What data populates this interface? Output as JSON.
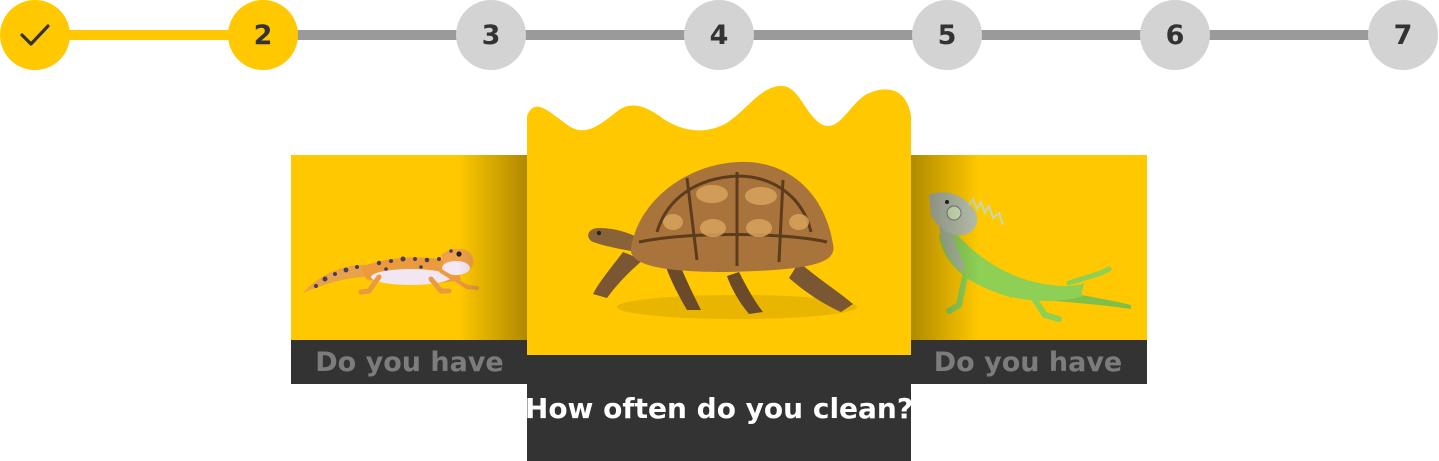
{
  "stepper": {
    "accent_color": "#FFC800",
    "pending_color": "#d3d3d3",
    "track_color": "#9a9a9a",
    "steps": [
      {
        "state": "completed",
        "label": "",
        "icon": "checkmark-icon"
      },
      {
        "state": "current",
        "label": "2"
      },
      {
        "state": "pending",
        "label": "3"
      },
      {
        "state": "pending",
        "label": "4"
      },
      {
        "state": "pending",
        "label": "5"
      },
      {
        "state": "pending",
        "label": "6"
      },
      {
        "state": "pending",
        "label": "7"
      }
    ]
  },
  "carousel": {
    "cards": [
      {
        "position": "previous",
        "animal": "leopard-gecko",
        "caption": "Do you have"
      },
      {
        "position": "active",
        "animal": "tortoise",
        "caption": "How often do you clean?"
      },
      {
        "position": "next",
        "animal": "green-iguana",
        "caption": "Do you have"
      }
    ]
  }
}
